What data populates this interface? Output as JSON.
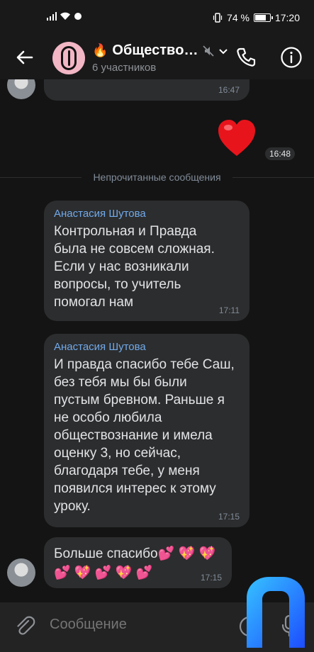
{
  "status_bar": {
    "battery": "74 %",
    "time": "17:20",
    "battery_level": 0.74
  },
  "header": {
    "title": "Обществo…",
    "title_emoji": "🔥",
    "subtitle": "6 участников"
  },
  "messages": {
    "prev_time": "16:47",
    "heart_emoji": "❤️",
    "heart_time": "16:48",
    "unread_divider": "Непрочитанные сообщения",
    "m1": {
      "sender": "Анастасия Шутова",
      "text": "Контрольная и Правда\nбыла не совсем сложная.\nЕсли у нас возникали\nвопросы, то учитель\nпомогал нам",
      "time": "17:11"
    },
    "m2": {
      "sender": "Анастасия Шутова",
      "text": "И правда спасибо тебе Саш,\nбез тебя мы бы были\nпустым бревном. Раньше я\nне особо любила\nобществознание и имела\nоценку 3, но сейчас,\nблагодаря тебе, у меня\nпоявился интерес к этому\nуроку.",
      "time": "17:15"
    },
    "m3": {
      "text": "Больше спасибо💕 💖 💖\n💕 💖 💕 💖 💕",
      "time": "17:15"
    }
  },
  "composer": {
    "placeholder": "Сообщение"
  },
  "colors": {
    "background": "#141414",
    "bubble": "#2c2d2e",
    "sender": "#71aaeb",
    "accent_logo": "#1e8cff"
  }
}
